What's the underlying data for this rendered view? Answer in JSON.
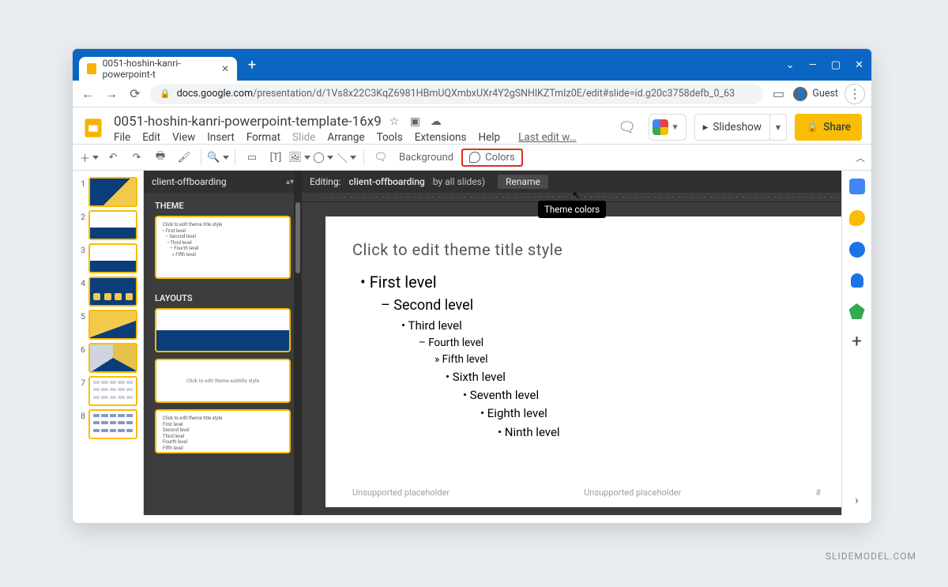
{
  "browser": {
    "tab_title": "0051-hoshin-kanri-powerpoint-t",
    "url_host": "docs.google.com",
    "url_path": "/presentation/d/1Vs8x22C3KqZ6981HBmUQXmbxUXr4Y2gSNHlKZTmIz0E/edit#slide=id.g20c3758defb_0_63",
    "guest_label": "Guest"
  },
  "titlebar": {
    "chevron": "⌄",
    "min": "—",
    "max": "▢",
    "close": "✕"
  },
  "doc": {
    "title": "0051-hoshin-kanri-powerpoint-template-16x9",
    "menus": [
      "File",
      "Edit",
      "View",
      "Insert",
      "Format",
      "Slide",
      "Arrange",
      "Tools",
      "Extensions",
      "Help"
    ],
    "last_edit": "Last edit w…"
  },
  "header_actions": {
    "slideshow": "Slideshow",
    "share": "Share"
  },
  "toolbar": {
    "background": "Background",
    "colors": "Colors",
    "tooltip": "Theme colors"
  },
  "theme_panel": {
    "name": "client-offboarding",
    "theme_label": "THEME",
    "layouts_label": "LAYOUTS",
    "preview_title": "Click to edit theme title style",
    "preview_lines": "• First level\n  – Second level\n    • Third level\n      – Fourth level\n        » Fifth level",
    "layout3_center": "Click to edit theme subtitle style",
    "layout4_title": "Click to edit theme title style",
    "layout4_lines": "First level\nSecond level\nThird level\nFourth level\nFifth level"
  },
  "editor": {
    "editing_prefix": "Editing:",
    "editing_name": "client-offboarding",
    "used_by": "by all slides)",
    "rename": "Rename"
  },
  "canvas": {
    "title": "Click to edit theme title style",
    "levels": {
      "l1": "• First level",
      "l2": "– Second level",
      "l3": "• Third level",
      "l4": "– Fourth level",
      "l5": "» Fifth level",
      "l6": "• Sixth level",
      "l7": "• Seventh level",
      "l8": "• Eighth level",
      "l9": "• Ninth level"
    },
    "placeholder_left": "Unsupported placeholder",
    "placeholder_mid": "Unsupported placeholder",
    "placeholder_right": "#"
  },
  "slide_numbers": [
    "1",
    "2",
    "3",
    "4",
    "5",
    "6",
    "7",
    "8"
  ],
  "watermark": "SLIDEMODEL.COM"
}
